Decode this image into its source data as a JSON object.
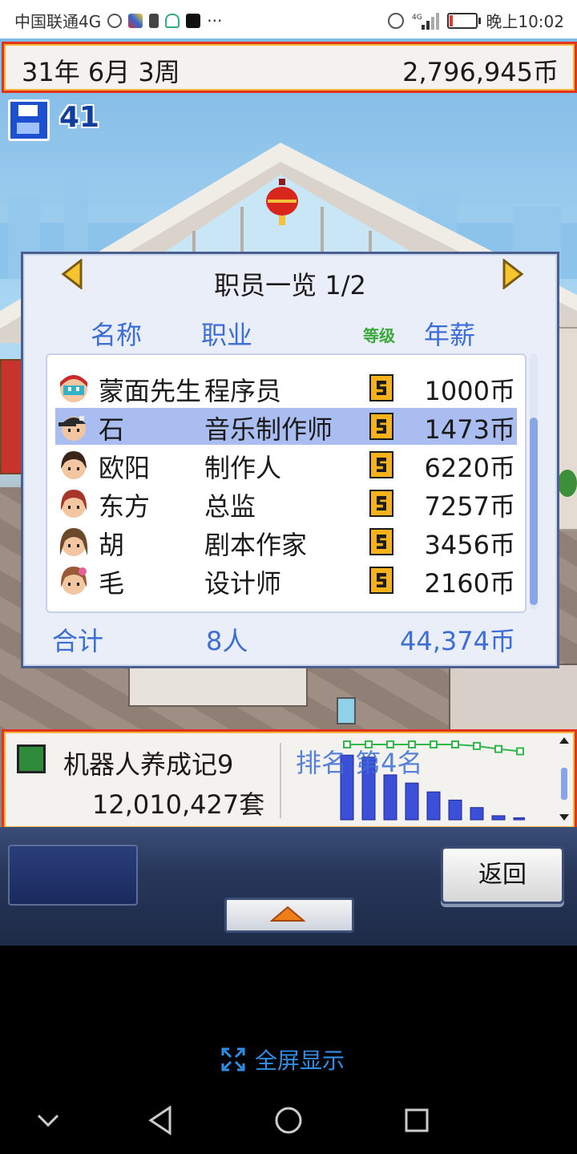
{
  "statusbar": {
    "carrier": "中国联通4G",
    "more": "···",
    "time": "晚上10:02",
    "icons": [
      "timer-icon",
      "app-icon",
      "battery-saver-icon",
      "headset-icon",
      "tiktok-icon",
      "alarm-icon",
      "signal-4g-icon",
      "battery-icon"
    ],
    "battery_level": 0.08
  },
  "game": {
    "date": "31年 6月 3周",
    "money": "2,796,945币",
    "save_count": "41",
    "staff_panel": {
      "title": "职员一览 1/2",
      "columns": {
        "name": "名称",
        "job": "职业",
        "level": "等级",
        "salary": "年薪"
      },
      "rows": [
        {
          "name": "蒙面先生",
          "job": "程序员",
          "level": "5",
          "salary": "1000币",
          "selected": false
        },
        {
          "name": "石",
          "job": "音乐制作师",
          "level": "5",
          "salary": "1473币",
          "selected": true
        },
        {
          "name": "欧阳",
          "job": "制作人",
          "level": "5",
          "salary": "6220币",
          "selected": false
        },
        {
          "name": "东方",
          "job": "总监",
          "level": "5",
          "salary": "7257币",
          "selected": false
        },
        {
          "name": "胡",
          "job": "剧本作家",
          "level": "5",
          "salary": "3456币",
          "selected": false
        },
        {
          "name": "毛",
          "job": "设计师",
          "level": "5",
          "salary": "2160币",
          "selected": false
        }
      ],
      "total": {
        "label": "合计",
        "count": "8人",
        "salary": "44,374币"
      }
    },
    "sales": {
      "game_name": "机器人养成记9",
      "copies": "12,010,427套",
      "rank": "排名 第4名",
      "chart_data": {
        "type": "bar",
        "categories": [
          "1",
          "2",
          "3",
          "4",
          "5",
          "6",
          "7",
          "8",
          "9"
        ],
        "values": [
          95,
          92,
          66,
          54,
          41,
          29,
          18,
          6,
          3
        ],
        "line_values": [
          99,
          99,
          99,
          99,
          99,
          99,
          97,
          93,
          90
        ],
        "colors": {
          "bar": "#3b4fd8",
          "line": "#2fb84a"
        }
      }
    },
    "menu": {
      "back_label": "返回"
    }
  },
  "fullscreen_label": "全屏显示",
  "navbar": {
    "icons": [
      "chevron-down-icon",
      "back-triangle-icon",
      "home-circle-icon",
      "recents-square-icon"
    ]
  }
}
